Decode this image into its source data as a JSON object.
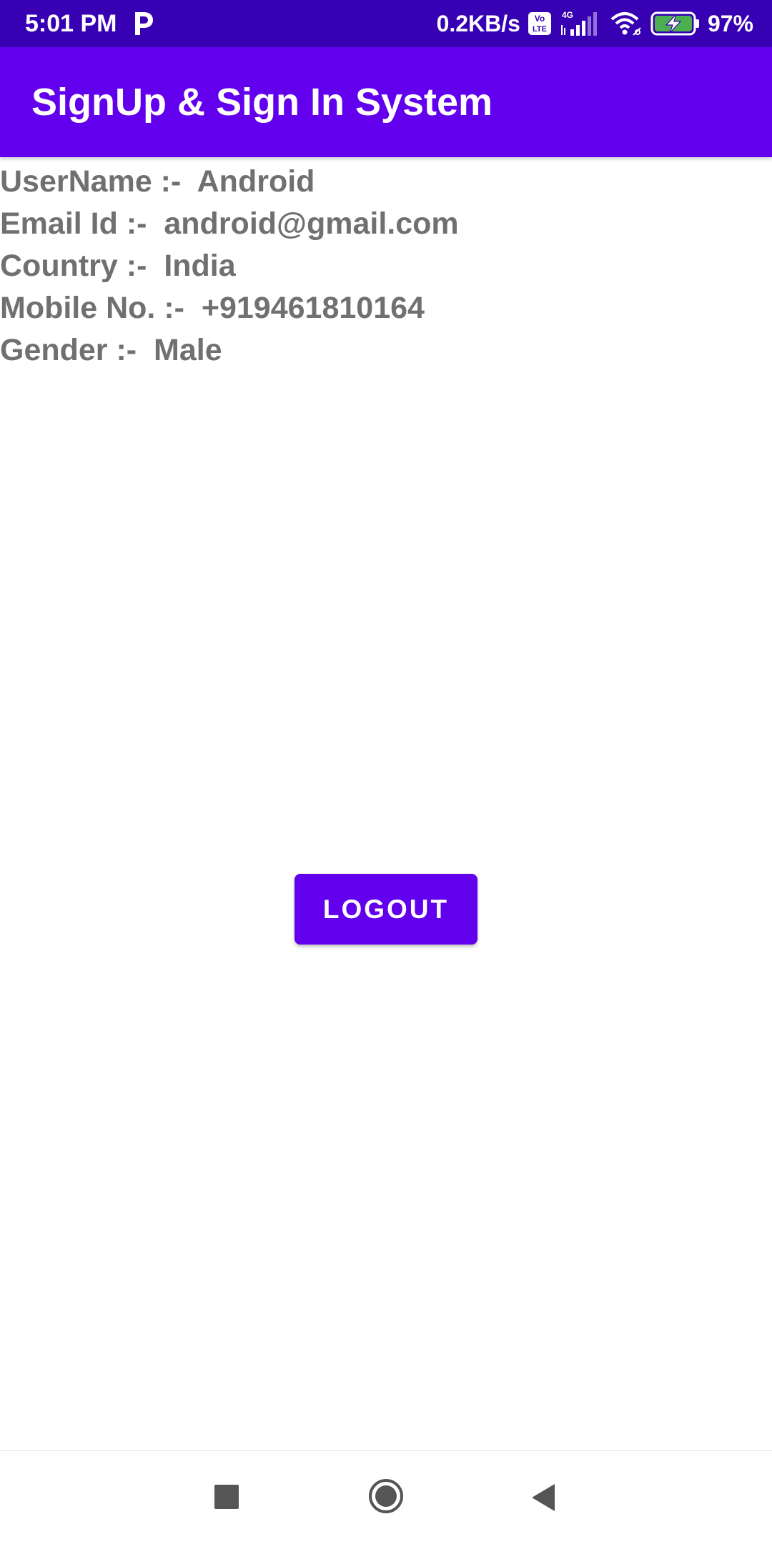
{
  "status_bar": {
    "time": "5:01 PM",
    "network_speed": "0.2KB/s",
    "network_type": "4G",
    "volte_top": "Vo",
    "volte_bottom": "LTE",
    "battery_percent": "97%",
    "icons": [
      "paytm-icon",
      "volte-icon",
      "signal-icon",
      "wifi-icon",
      "battery-charging-icon"
    ]
  },
  "app_bar": {
    "title": "SignUp & Sign In System"
  },
  "profile": {
    "rows": [
      {
        "label": "UserName :-  ",
        "value": "Android"
      },
      {
        "label": "Email Id :-  ",
        "value": "android@gmail.com"
      },
      {
        "label": "Country :-  ",
        "value": "India"
      },
      {
        "label": "Mobile No. :-  ",
        "value": "+919461810164"
      },
      {
        "label": "Gender :-  ",
        "value": "Male"
      }
    ]
  },
  "actions": {
    "logout_label": "LOGOUT"
  },
  "nav_bar": {
    "icons": [
      "recents-icon",
      "home-icon",
      "back-icon"
    ]
  },
  "colors": {
    "status_bar": "#3700b3",
    "primary": "#6200ee",
    "text": "#707070",
    "battery_fill": "#4caf50"
  }
}
